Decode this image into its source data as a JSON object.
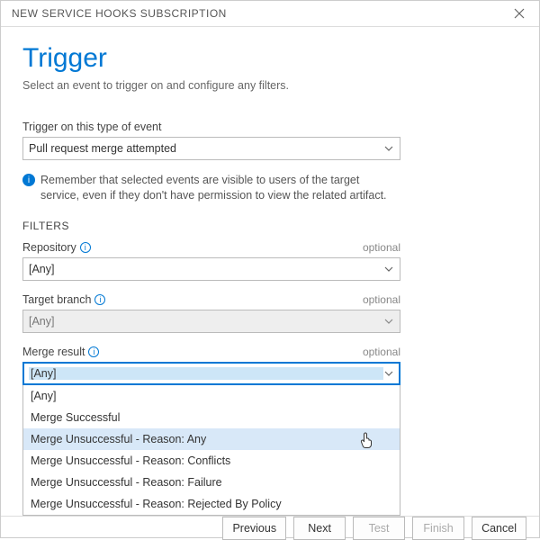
{
  "titlebar": {
    "title": "NEW SERVICE HOOKS SUBSCRIPTION"
  },
  "page": {
    "heading": "Trigger",
    "subtitle": "Select an event to trigger on and configure any filters."
  },
  "event": {
    "label": "Trigger on this type of event",
    "value": "Pull request merge attempted"
  },
  "info": {
    "text": "Remember that selected events are visible to users of the target service, even if they don't have permission to view the related artifact."
  },
  "filters": {
    "header": "FILTERS",
    "optional_label": "optional",
    "repository": {
      "label": "Repository",
      "value": "[Any]"
    },
    "target_branch": {
      "label": "Target branch",
      "value": "[Any]"
    },
    "merge_result": {
      "label": "Merge result",
      "value": "[Any]",
      "options": [
        "[Any]",
        "Merge Successful",
        "Merge Unsuccessful - Reason: Any",
        "Merge Unsuccessful - Reason: Conflicts",
        "Merge Unsuccessful - Reason: Failure",
        "Merge Unsuccessful - Reason: Rejected By Policy"
      ],
      "highlighted_index": 2
    }
  },
  "buttons": {
    "previous": "Previous",
    "next": "Next",
    "test": "Test",
    "finish": "Finish",
    "cancel": "Cancel"
  }
}
